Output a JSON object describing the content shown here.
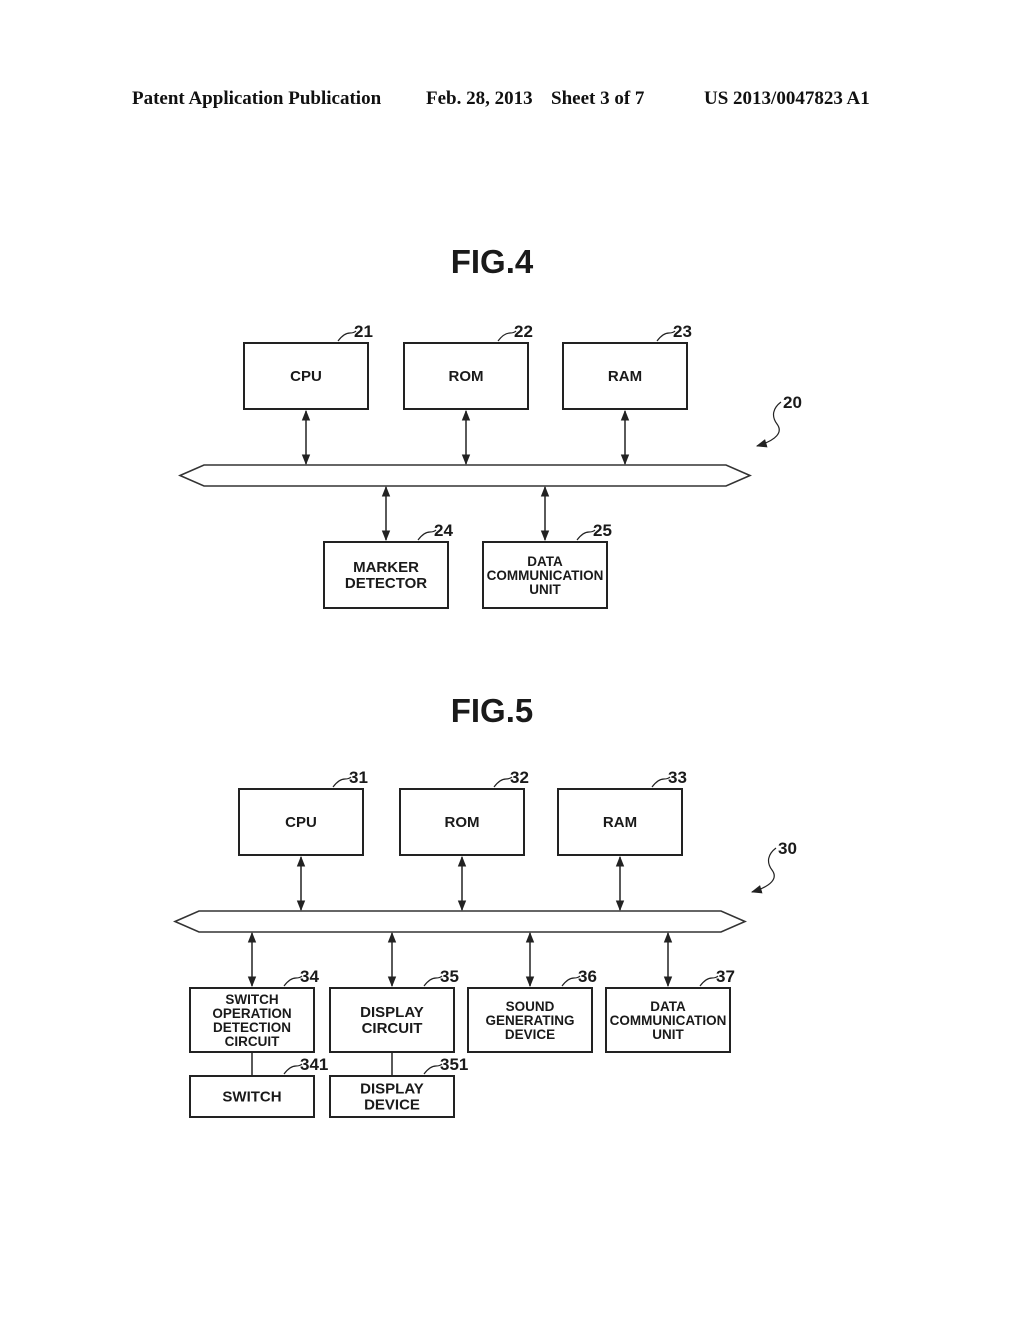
{
  "header": {
    "publication": "Patent Application Publication",
    "date": "Feb. 28, 2013",
    "sheet": "Sheet 3 of 7",
    "number": "US 2013/0047823 A1"
  },
  "figures": [
    {
      "id": "fig4",
      "title": "FIG.4",
      "system_ref": "20",
      "top_blocks": [
        {
          "ref": "21",
          "lines": [
            "CPU"
          ]
        },
        {
          "ref": "22",
          "lines": [
            "ROM"
          ]
        },
        {
          "ref": "23",
          "lines": [
            "RAM"
          ]
        }
      ],
      "bottom_blocks": [
        {
          "ref": "24",
          "lines": [
            "MARKER",
            "DETECTOR"
          ]
        },
        {
          "ref": "25",
          "lines": [
            "DATA",
            "COMMUNICATION",
            "UNIT"
          ]
        }
      ],
      "sub_blocks": []
    },
    {
      "id": "fig5",
      "title": "FIG.5",
      "system_ref": "30",
      "top_blocks": [
        {
          "ref": "31",
          "lines": [
            "CPU"
          ]
        },
        {
          "ref": "32",
          "lines": [
            "ROM"
          ]
        },
        {
          "ref": "33",
          "lines": [
            "RAM"
          ]
        }
      ],
      "bottom_blocks": [
        {
          "ref": "34",
          "lines": [
            "SWITCH",
            "OPERATION",
            "DETECTION",
            "CIRCUIT"
          ]
        },
        {
          "ref": "35",
          "lines": [
            "DISPLAY",
            "CIRCUIT"
          ]
        },
        {
          "ref": "36",
          "lines": [
            "SOUND",
            "GENERATING",
            "DEVICE"
          ]
        },
        {
          "ref": "37",
          "lines": [
            "DATA",
            "COMMUNICATION",
            "UNIT"
          ]
        }
      ],
      "sub_blocks": [
        {
          "ref": "341",
          "parent": "34",
          "lines": [
            "SWITCH"
          ]
        },
        {
          "ref": "351",
          "parent": "35",
          "lines": [
            "DISPLAY",
            "DEVICE"
          ]
        }
      ]
    }
  ]
}
